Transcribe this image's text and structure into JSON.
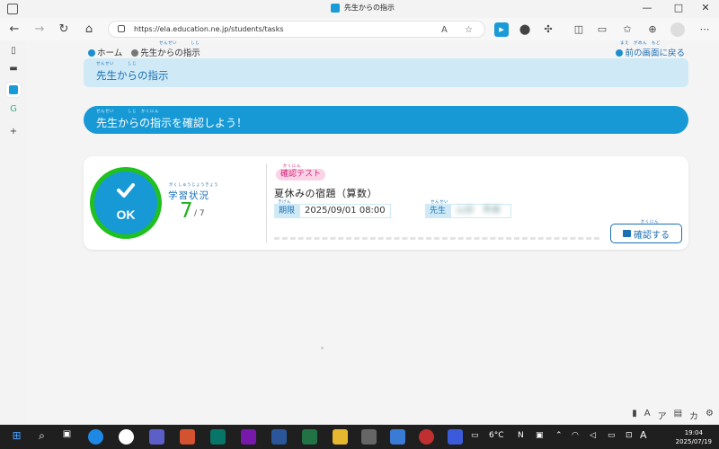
{
  "browser": {
    "tab_title": "先生からの指示",
    "url": "https://ela.education.ne.jp/students/tasks",
    "window_controls": [
      "—",
      "□",
      "✕"
    ]
  },
  "breadcrumb": {
    "home_label": "ホーム",
    "current_label": "先生からの指示",
    "current_ruby": "せんせい　　　しじ",
    "back_label": "前の画面に戻る",
    "back_ruby": "まえ　がめん　もど"
  },
  "header": {
    "title": "先生からの指示",
    "title_ruby": "せんせい　　　しじ"
  },
  "instruction": {
    "text": "先生からの指示を確認しよう！",
    "ruby": "せんせい　　　しじ　かくにん"
  },
  "task": {
    "status_ok": "OK",
    "status_label": "学習状況",
    "status_label_ruby": "がくしゅうじょうきょう",
    "done_count": "7",
    "total": "7",
    "tag": "確認テスト",
    "tag_ruby": "かくにん",
    "title": "夏休みの宿題（算数）",
    "deadline_label": "期限",
    "deadline_ruby": "きげん",
    "deadline_value": "2025/09/01 08:00",
    "teacher_label": "先生",
    "teacher_ruby": "せんせい",
    "teacher_name": "山田　秀樹",
    "confirm_button": "確認する",
    "confirm_ruby": "かくにん"
  },
  "taskbar": {
    "weather": "6°C",
    "ime": "A",
    "time": "19:04",
    "date": "2025/07/19"
  },
  "colors": {
    "accent": "#1799d5",
    "ok_ring": "#21c021",
    "tag_bg": "#fbd3e6",
    "light_banner": "#cfeaf6"
  }
}
